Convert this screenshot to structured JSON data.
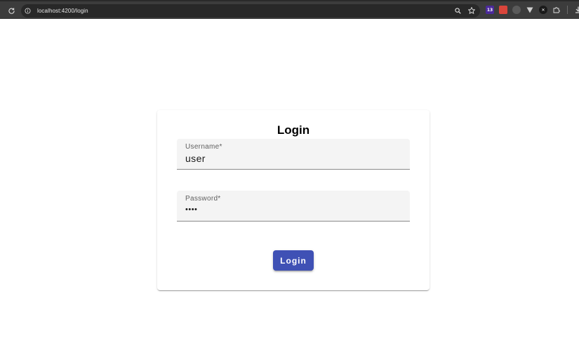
{
  "browser": {
    "url": "localhost:4200/login",
    "extension_badge": "13",
    "colors": {
      "toolbar": "#3c3c3c",
      "omnibox": "#282828"
    },
    "icons": [
      "reload-icon",
      "site-info-icon",
      "zoom-icon",
      "bookmark-star-icon",
      "extension-icon",
      "extensions-puzzle-icon",
      "download-icon"
    ]
  },
  "login_card": {
    "title": "Login",
    "username": {
      "label": "Username*",
      "value": "user"
    },
    "password": {
      "label": "Password*",
      "value": "••••"
    },
    "submit_label": "Login",
    "colors": {
      "primary": "#3f51b5",
      "field_bg": "#f4f4f4"
    }
  }
}
